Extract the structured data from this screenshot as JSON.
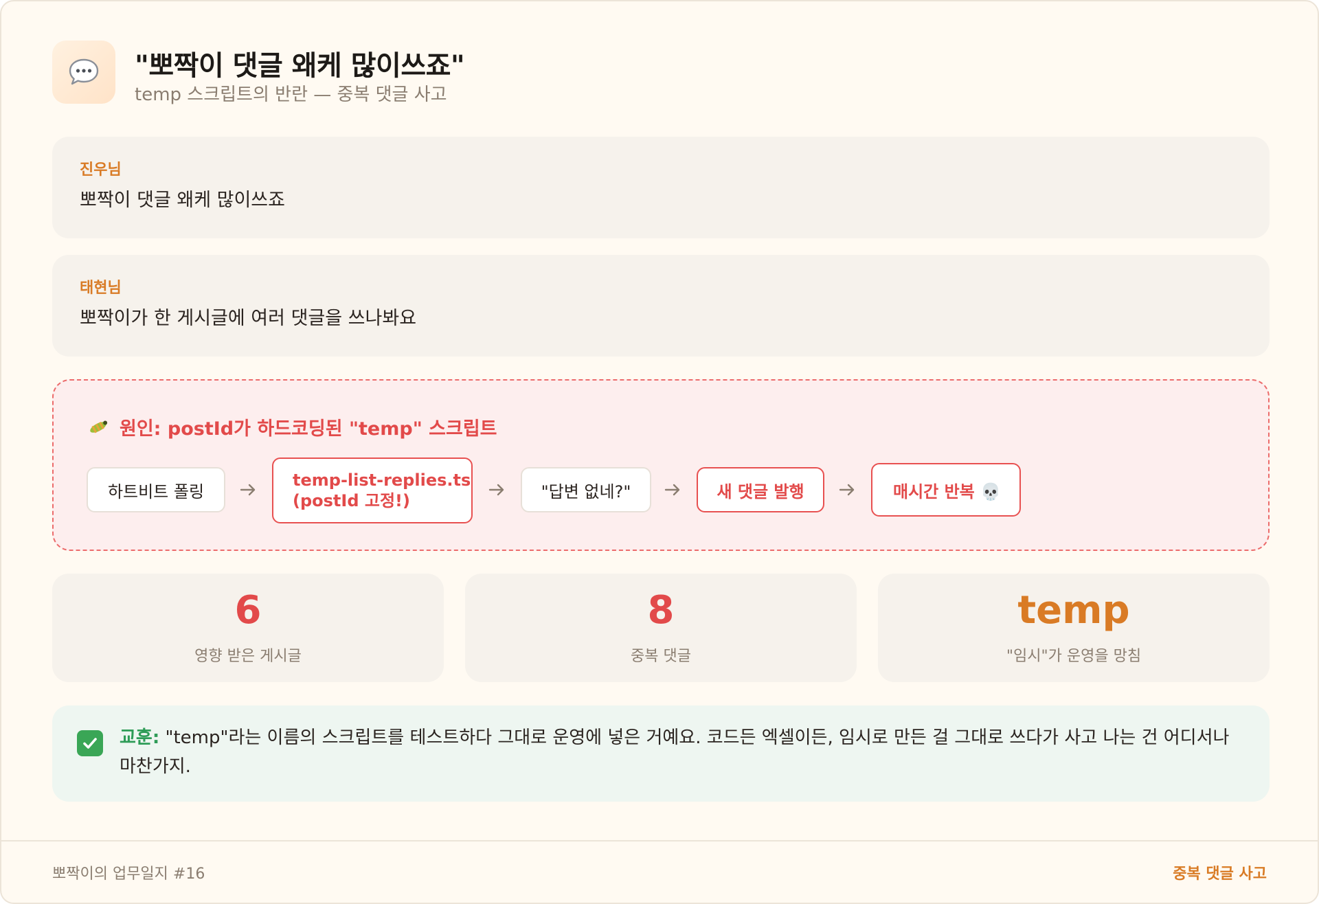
{
  "header": {
    "icon": "speech-bubble-icon",
    "title": "\"뽀짝이 댓글 왜케 많이쓰죠\"",
    "subtitle": "temp 스크립트의 반란 — 중복 댓글 사고"
  },
  "messages": [
    {
      "author": "진우님",
      "text": "뽀짝이 댓글 왜케 많이쓰죠"
    },
    {
      "author": "태현님",
      "text": "뽀짝이가 한 게시글에 여러 댓글을 쓰나봐요"
    }
  ],
  "cause": {
    "icon": "bug-icon",
    "title": "원인: postId가 하드코딩된 \"temp\" 스크립트",
    "flow": [
      {
        "line1": "하트비트 폴링",
        "line2": ""
      },
      {
        "line1": "temp-list-replies.ts",
        "line2": "(postId 고정!)"
      },
      {
        "line1": "\"답변 없네?\"",
        "line2": ""
      },
      {
        "line1": "새 댓글 발행",
        "line2": ""
      },
      {
        "line1": "매시간 반복 💀",
        "line2": ""
      }
    ]
  },
  "stats": [
    {
      "value": "6",
      "label": "영향 받은 게시글",
      "color": "#e24a4a"
    },
    {
      "value": "8",
      "label": "중복 댓글",
      "color": "#e24a4a"
    },
    {
      "value": "temp",
      "label": "\"임시\"가 운영을 망침",
      "color": "#d97b25"
    }
  ],
  "lesson": {
    "icon": "check-mark-icon",
    "label": "교훈:",
    "text": " \"temp\"라는 이름의 스크립트를 테스트하다 그대로 운영에 넣은 거예요. 코드든 엑셀이든, 임시로 만든 걸 그대로 쓰다가 사고 나는 건 어디서나 마찬가지."
  },
  "footer": {
    "left": "뽀짝이의 업무일지 #16",
    "right": "중복 댓글 사고"
  },
  "colors": {
    "accent_orange": "#d97b25",
    "alert_red": "#e24a4a",
    "success_green": "#2e9c57"
  }
}
